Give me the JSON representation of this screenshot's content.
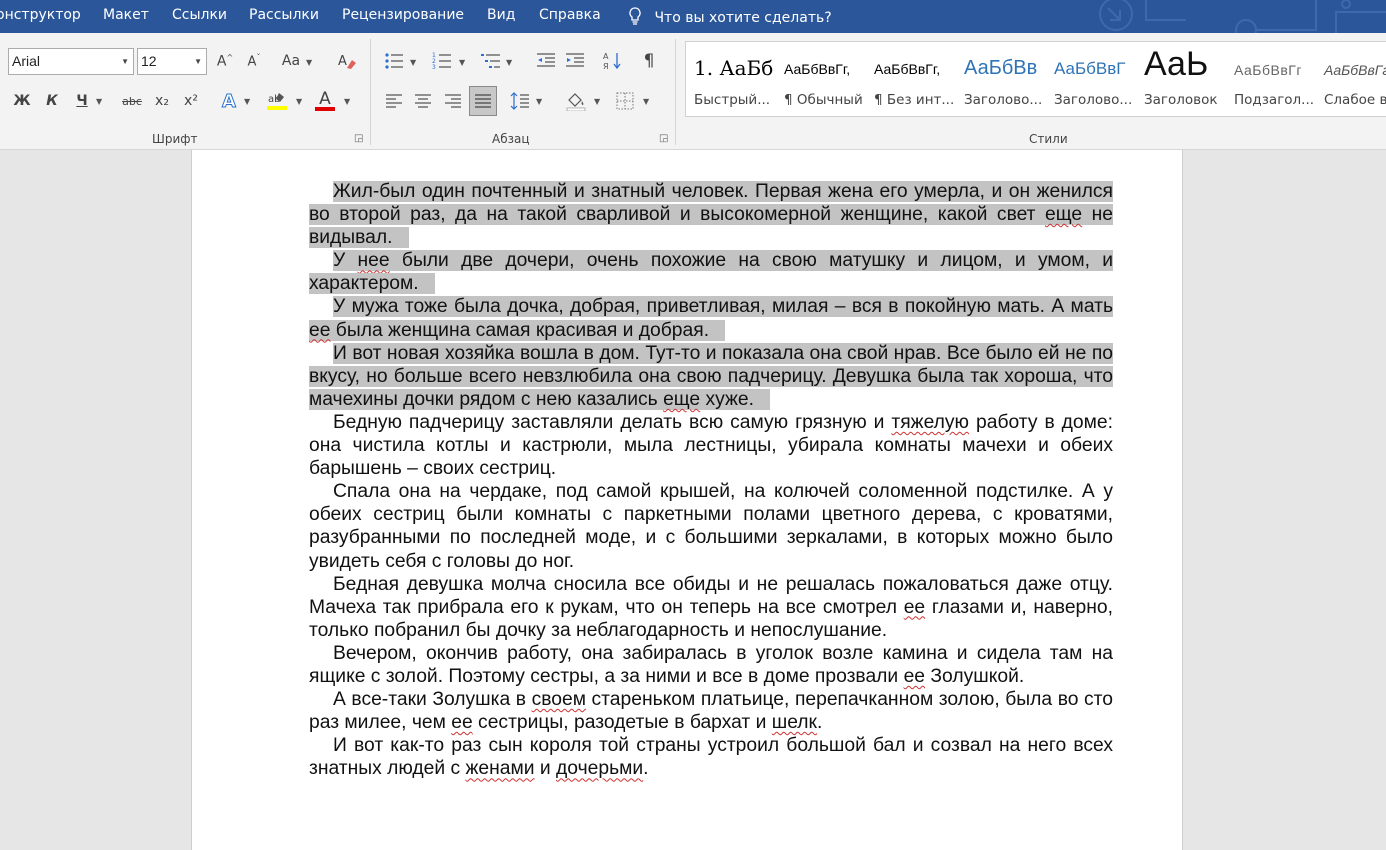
{
  "menu": {
    "tabs": [
      "онструктор",
      "Макет",
      "Ссылки",
      "Рассылки",
      "Рецензирование",
      "Вид",
      "Справка"
    ],
    "tell_me": "Что вы хотите сделать?"
  },
  "font_group": {
    "label": "Шрифт",
    "font_name": "Arial",
    "font_size": "12",
    "change_case": "Aa",
    "bold": "Ж",
    "italic": "К",
    "underline": "Ч",
    "strike": "abc",
    "subscript": "x₂",
    "superscript": "x²",
    "text_effects": "A",
    "font_color": "A"
  },
  "paragraph_group": {
    "label": "Абзац"
  },
  "styles_group": {
    "label": "Стили",
    "items": [
      {
        "preview": "1. АаБб",
        "name": "Быстрый..."
      },
      {
        "preview": "АаБбВвГг,",
        "name": "¶ Обычный"
      },
      {
        "preview": "АаБбВвГг,",
        "name": "¶ Без инт..."
      },
      {
        "preview": "АаБбВв",
        "name": "Заголово..."
      },
      {
        "preview": "АаБбВвГ",
        "name": "Заголово..."
      },
      {
        "preview": "АаЬ",
        "name": "Заголовок"
      },
      {
        "preview": "АаБбВвГг",
        "name": "Подзагол..."
      },
      {
        "preview": "АаБбВвГг",
        "name": "Слабое в"
      }
    ]
  },
  "document": {
    "paragraphs": [
      {
        "highlight": true,
        "parts": [
          [
            "Жил-был один почтенный и знатный человек. Первая жена его умерла, и он женился во второй раз, да на такой сварливой и высокомерной женщине, какой свет ",
            false
          ],
          [
            "еще",
            true
          ],
          [
            " не видывал.",
            false
          ]
        ]
      },
      {
        "highlight": true,
        "parts": [
          [
            "У ",
            false
          ],
          [
            "нее",
            true
          ],
          [
            " были две дочери, очень похожие на свою матушку и лицом, и умом, и характером.",
            false
          ]
        ]
      },
      {
        "highlight": true,
        "parts": [
          [
            "У мужа тоже была дочка, добрая, приветливая, милая – вся в покойную мать. А мать ",
            false
          ],
          [
            "ее",
            true
          ],
          [
            " была женщина самая красивая и добрая.",
            false
          ]
        ]
      },
      {
        "highlight": true,
        "parts": [
          [
            "И вот новая хозяйка вошла в дом. Тут-то и показала она свой нрав. Все было ей не по вкусу, но больше всего невзлюбила она свою падчерицу. Девушка была так хороша, что мачехины дочки рядом с нею казались ",
            false
          ],
          [
            "еще",
            true
          ],
          [
            " хуже.",
            false
          ]
        ]
      },
      {
        "highlight": false,
        "parts": [
          [
            "Бедную падчерицу заставляли делать всю самую грязную и ",
            false
          ],
          [
            "тяжелую",
            true
          ],
          [
            " работу в доме: она чистила котлы и кастрюли, мыла лестницы, убирала комнаты мачехи и обеих барышень – своих сестриц.",
            false
          ]
        ]
      },
      {
        "highlight": false,
        "parts": [
          [
            "Спала она на чердаке, под самой крышей, на колючей соломенной подстилке. А у обеих сестриц были комнаты с паркетными полами цветного дерева, с кроватями, разубранными по последней моде, и с большими зеркалами, в которых можно было увидеть себя с головы до ног.",
            false
          ]
        ]
      },
      {
        "highlight": false,
        "parts": [
          [
            "Бедная девушка молча сносила все обиды и не решалась пожаловаться даже отцу. Мачеха так прибрала его к рукам, что он теперь на все смотрел ",
            false
          ],
          [
            "ее",
            true
          ],
          [
            " глазами и, наверно, только побранил бы дочку за неблагодарность и непослушание.",
            false
          ]
        ]
      },
      {
        "highlight": false,
        "parts": [
          [
            "Вечером, окончив работу, она забиралась в уголок возле камина и сидела там на ящике с золой. Поэтому сестры, а за ними и все в доме прозвали ",
            false
          ],
          [
            "ее",
            true
          ],
          [
            " Золушкой.",
            false
          ]
        ]
      },
      {
        "highlight": false,
        "parts": [
          [
            "А все-таки Золушка в ",
            false
          ],
          [
            "своем",
            true
          ],
          [
            " стареньком платьице, перепачканном золою, была во сто раз милее, чем ",
            false
          ],
          [
            "ее",
            true
          ],
          [
            " сестрицы, разодетые в бархат и ",
            false
          ],
          [
            "шелк",
            true
          ],
          [
            ".",
            false
          ]
        ]
      },
      {
        "highlight": false,
        "parts": [
          [
            "И вот как-то раз сын короля той страны устроил большой бал и созвал на него всех знатных людей с ",
            false
          ],
          [
            "женами",
            true
          ],
          [
            " и ",
            false
          ],
          [
            "дочерьми",
            true
          ],
          [
            ".",
            false
          ]
        ]
      }
    ]
  }
}
